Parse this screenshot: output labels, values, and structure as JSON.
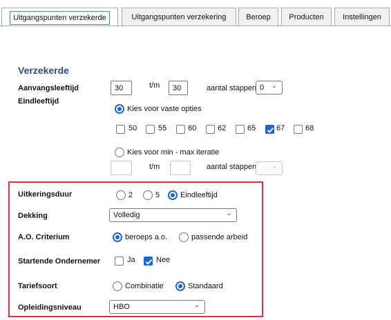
{
  "tabs": [
    {
      "label": "Uitgangspunten verzekerde",
      "active": true
    },
    {
      "label": "Uitgangspunten verzekering",
      "active": false
    },
    {
      "label": "Beroep",
      "active": false
    },
    {
      "label": "Producten",
      "active": false
    },
    {
      "label": "Instellingen",
      "active": false
    }
  ],
  "section_title": "Verzekerde",
  "aanvangsleeftijd": {
    "label": "Aanvangsleeftijd",
    "from": "30",
    "tm": "t/m",
    "to": "30",
    "steps_label": "aantal stappen",
    "steps_value": "0"
  },
  "eindleeftijd": {
    "label": "Eindleeftijd",
    "fixed_option_label": "Kies voor vaste opties",
    "fixed_selected": true,
    "options": [
      {
        "label": "50",
        "checked": false
      },
      {
        "label": "55",
        "checked": false
      },
      {
        "label": "60",
        "checked": false
      },
      {
        "label": "62",
        "checked": false
      },
      {
        "label": "65",
        "checked": false
      },
      {
        "label": "67",
        "checked": true
      },
      {
        "label": "68",
        "checked": false
      }
    ],
    "iteration_option_label": "Kies voor min - max iteratie",
    "iteration_selected": false,
    "iter_from": "",
    "iter_tm": "t/m",
    "iter_to": "",
    "iter_steps_label": "aantal stappen",
    "iter_steps_value": ""
  },
  "uitkeringsduur": {
    "label": "Uitkeringsduur",
    "options": [
      {
        "label": "2",
        "checked": false
      },
      {
        "label": "5",
        "checked": false
      },
      {
        "label": "Eindleeftijd",
        "checked": true
      }
    ]
  },
  "dekking": {
    "label": "Dekking",
    "value": "Volledig"
  },
  "ao_criterium": {
    "label": "A.O. Criterium",
    "options": [
      {
        "label": "beroeps a.o.",
        "checked": true
      },
      {
        "label": "passende arbeid",
        "checked": false
      }
    ]
  },
  "startende_ondernemer": {
    "label": "Startende Ondernemer",
    "options": [
      {
        "label": "Ja",
        "checked": false
      },
      {
        "label": "Nee",
        "checked": true
      }
    ]
  },
  "tariefsoort": {
    "label": "Tariefsoort",
    "options": [
      {
        "label": "Combinatie",
        "checked": false
      },
      {
        "label": "Standaard",
        "checked": true
      }
    ]
  },
  "opleidingsniveau": {
    "label": "Opleidingsniveau",
    "value": "HBO"
  },
  "colors": {
    "accent": "#1a66d9",
    "section_title": "#2a4e7e",
    "highlight": "#e0303c"
  }
}
